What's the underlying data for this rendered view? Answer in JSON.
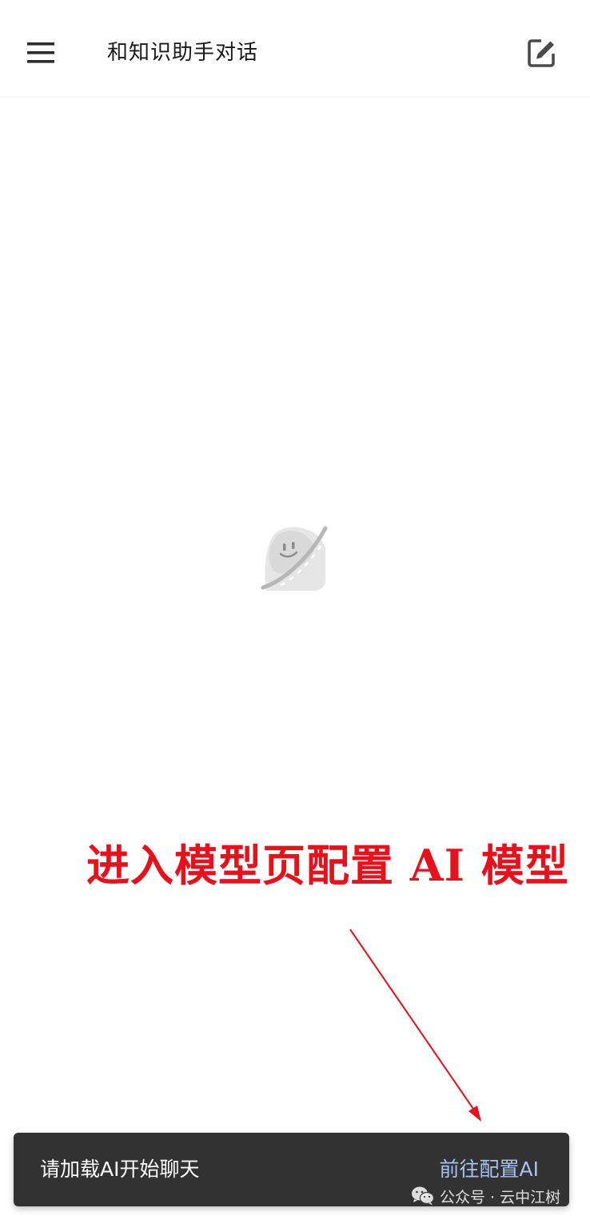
{
  "app_bar": {
    "title": "和知识助手对话",
    "menu_icon": "hamburger-menu-icon",
    "edit_icon": "edit-new-chat-icon"
  },
  "main": {
    "empty_state_icon": "empty-chat-illustration-icon"
  },
  "annotation": {
    "text": "进入模型页配置 AI 模型",
    "color": "#e8101a"
  },
  "snackbar": {
    "message": "请加载AI开始聊天",
    "action_label": "前往配置AI",
    "background": "#323232",
    "action_color": "#a7c2f0"
  },
  "watermark": {
    "icon": "wechat-icon",
    "text": "公众号 · 云中江树"
  }
}
